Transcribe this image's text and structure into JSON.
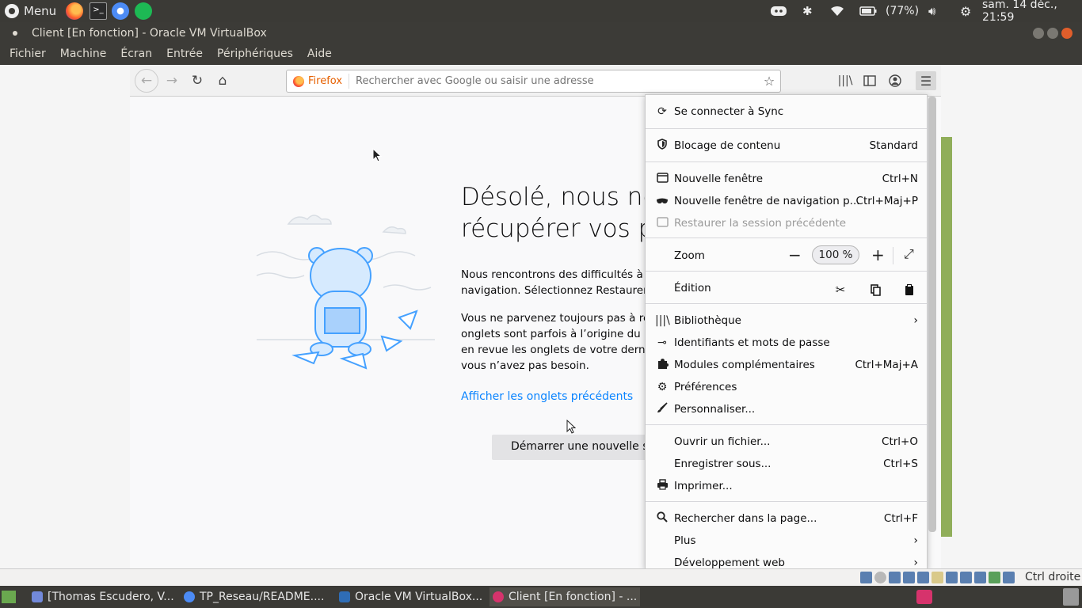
{
  "system_panel": {
    "menu_label": "Menu",
    "battery": "(77%)",
    "datetime": "sam. 14 déc., 21:59"
  },
  "vbox": {
    "window_title": "Client [En fonction] - Oracle VM VirtualBox",
    "menu": [
      "Fichier",
      "Machine",
      "Écran",
      "Entrée",
      "Périphériques",
      "Aide"
    ],
    "status_host_key": "Ctrl droite"
  },
  "firefox": {
    "identity_label": "Firefox",
    "url_placeholder": "Rechercher avec Google ou saisir une adresse"
  },
  "page": {
    "heading_line1": "Désolé, nous ne",
    "heading_line2": "récupérer vos pa",
    "para1_line1": "Nous rencontrons des difficultés à r",
    "para1_line2": "navigation. Sélectionnez Restaurer",
    "para2_line1": "Vous ne parvenez toujours pas à re",
    "para2_line2": "onglets sont parfois à l’origine du pr",
    "para2_line3": "en revue les onglets de votre derni",
    "para2_line4": "vous n’avez pas besoin.",
    "link": "Afficher les onglets précédents",
    "new_session_button": "Démarrer une nouvelle se"
  },
  "appmenu": {
    "sync": "Se connecter à Sync",
    "content_blocking": "Blocage de contenu",
    "content_blocking_value": "Standard",
    "new_window": "Nouvelle fenêtre",
    "new_window_shortcut": "Ctrl+N",
    "private_window": "Nouvelle fenêtre de navigation p...",
    "private_window_shortcut": "Ctrl+Maj+P",
    "restore_session": "Restaurer la session précédente",
    "zoom_label": "Zoom",
    "zoom_value": "100 %",
    "edit_label": "Édition",
    "library": "Bibliothèque",
    "logins": "Identifiants et mots de passe",
    "addons": "Modules complémentaires",
    "addons_shortcut": "Ctrl+Maj+A",
    "preferences": "Préférences",
    "customize": "Personnaliser...",
    "open_file": "Ouvrir un fichier...",
    "open_file_shortcut": "Ctrl+O",
    "save_as": "Enregistrer sous...",
    "save_as_shortcut": "Ctrl+S",
    "print": "Imprimer...",
    "find": "Rechercher dans la page...",
    "find_shortcut": "Ctrl+F",
    "more": "Plus",
    "web_dev": "Développement web"
  },
  "taskbar": {
    "items": [
      "[Thomas Escudero, V...",
      "TP_Reseau/README....",
      "Oracle VM VirtualBox...",
      "Client [En fonction] - ..."
    ]
  },
  "colors": {
    "panel_bg": "#3b3a36",
    "link_blue": "#0a84ff",
    "firefox_orange": "#e66000",
    "scroll_green": "#90ae5a"
  }
}
